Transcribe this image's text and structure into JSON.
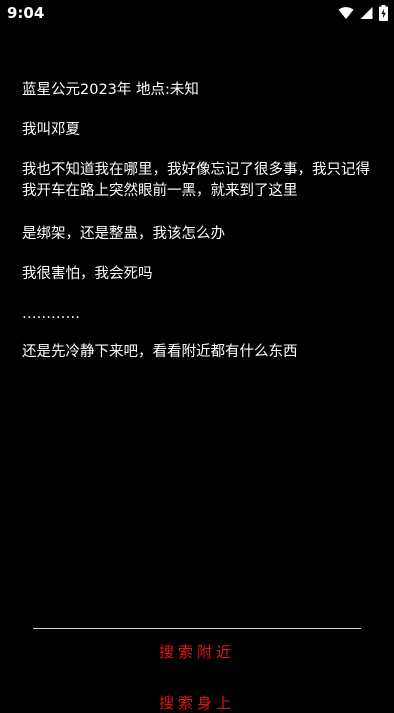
{
  "status_bar": {
    "time": "9:04",
    "icons": [
      "wifi-icon",
      "cellular-signal-icon",
      "battery-charging-icon"
    ]
  },
  "story": {
    "lines": [
      "蓝星公元2023年 地点:未知",
      "我叫邓夏",
      "我也不知道我在哪里，我好像忘记了很多事，我只记得我开车在路上突然眼前一黑，就来到了这里",
      "是绑架，还是整蛊，我该怎么办",
      "我很害怕，我会死吗",
      "…………",
      "还是先冷静下来吧，看看附近都有什么东西"
    ]
  },
  "actions": {
    "search_nearby": "搜索附近",
    "second_action": "搜索身上"
  },
  "colors": {
    "background": "#000000",
    "text": "#ffffff",
    "action": "#e0141a",
    "divider": "#cfcfcf"
  }
}
